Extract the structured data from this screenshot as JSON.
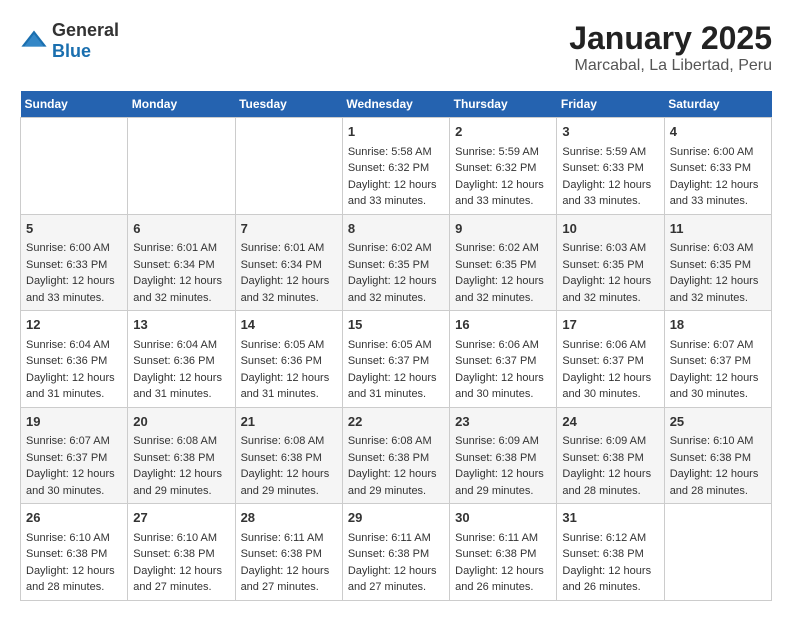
{
  "header": {
    "logo_general": "General",
    "logo_blue": "Blue",
    "month": "January 2025",
    "location": "Marcabal, La Libertad, Peru"
  },
  "days_of_week": [
    "Sunday",
    "Monday",
    "Tuesday",
    "Wednesday",
    "Thursday",
    "Friday",
    "Saturday"
  ],
  "weeks": [
    [
      {
        "day": "",
        "sunrise": "",
        "sunset": "",
        "daylight": ""
      },
      {
        "day": "",
        "sunrise": "",
        "sunset": "",
        "daylight": ""
      },
      {
        "day": "",
        "sunrise": "",
        "sunset": "",
        "daylight": ""
      },
      {
        "day": "1",
        "sunrise": "Sunrise: 5:58 AM",
        "sunset": "Sunset: 6:32 PM",
        "daylight": "Daylight: 12 hours and 33 minutes."
      },
      {
        "day": "2",
        "sunrise": "Sunrise: 5:59 AM",
        "sunset": "Sunset: 6:32 PM",
        "daylight": "Daylight: 12 hours and 33 minutes."
      },
      {
        "day": "3",
        "sunrise": "Sunrise: 5:59 AM",
        "sunset": "Sunset: 6:33 PM",
        "daylight": "Daylight: 12 hours and 33 minutes."
      },
      {
        "day": "4",
        "sunrise": "Sunrise: 6:00 AM",
        "sunset": "Sunset: 6:33 PM",
        "daylight": "Daylight: 12 hours and 33 minutes."
      }
    ],
    [
      {
        "day": "5",
        "sunrise": "Sunrise: 6:00 AM",
        "sunset": "Sunset: 6:33 PM",
        "daylight": "Daylight: 12 hours and 33 minutes."
      },
      {
        "day": "6",
        "sunrise": "Sunrise: 6:01 AM",
        "sunset": "Sunset: 6:34 PM",
        "daylight": "Daylight: 12 hours and 32 minutes."
      },
      {
        "day": "7",
        "sunrise": "Sunrise: 6:01 AM",
        "sunset": "Sunset: 6:34 PM",
        "daylight": "Daylight: 12 hours and 32 minutes."
      },
      {
        "day": "8",
        "sunrise": "Sunrise: 6:02 AM",
        "sunset": "Sunset: 6:35 PM",
        "daylight": "Daylight: 12 hours and 32 minutes."
      },
      {
        "day": "9",
        "sunrise": "Sunrise: 6:02 AM",
        "sunset": "Sunset: 6:35 PM",
        "daylight": "Daylight: 12 hours and 32 minutes."
      },
      {
        "day": "10",
        "sunrise": "Sunrise: 6:03 AM",
        "sunset": "Sunset: 6:35 PM",
        "daylight": "Daylight: 12 hours and 32 minutes."
      },
      {
        "day": "11",
        "sunrise": "Sunrise: 6:03 AM",
        "sunset": "Sunset: 6:35 PM",
        "daylight": "Daylight: 12 hours and 32 minutes."
      }
    ],
    [
      {
        "day": "12",
        "sunrise": "Sunrise: 6:04 AM",
        "sunset": "Sunset: 6:36 PM",
        "daylight": "Daylight: 12 hours and 31 minutes."
      },
      {
        "day": "13",
        "sunrise": "Sunrise: 6:04 AM",
        "sunset": "Sunset: 6:36 PM",
        "daylight": "Daylight: 12 hours and 31 minutes."
      },
      {
        "day": "14",
        "sunrise": "Sunrise: 6:05 AM",
        "sunset": "Sunset: 6:36 PM",
        "daylight": "Daylight: 12 hours and 31 minutes."
      },
      {
        "day": "15",
        "sunrise": "Sunrise: 6:05 AM",
        "sunset": "Sunset: 6:37 PM",
        "daylight": "Daylight: 12 hours and 31 minutes."
      },
      {
        "day": "16",
        "sunrise": "Sunrise: 6:06 AM",
        "sunset": "Sunset: 6:37 PM",
        "daylight": "Daylight: 12 hours and 30 minutes."
      },
      {
        "day": "17",
        "sunrise": "Sunrise: 6:06 AM",
        "sunset": "Sunset: 6:37 PM",
        "daylight": "Daylight: 12 hours and 30 minutes."
      },
      {
        "day": "18",
        "sunrise": "Sunrise: 6:07 AM",
        "sunset": "Sunset: 6:37 PM",
        "daylight": "Daylight: 12 hours and 30 minutes."
      }
    ],
    [
      {
        "day": "19",
        "sunrise": "Sunrise: 6:07 AM",
        "sunset": "Sunset: 6:37 PM",
        "daylight": "Daylight: 12 hours and 30 minutes."
      },
      {
        "day": "20",
        "sunrise": "Sunrise: 6:08 AM",
        "sunset": "Sunset: 6:38 PM",
        "daylight": "Daylight: 12 hours and 29 minutes."
      },
      {
        "day": "21",
        "sunrise": "Sunrise: 6:08 AM",
        "sunset": "Sunset: 6:38 PM",
        "daylight": "Daylight: 12 hours and 29 minutes."
      },
      {
        "day": "22",
        "sunrise": "Sunrise: 6:08 AM",
        "sunset": "Sunset: 6:38 PM",
        "daylight": "Daylight: 12 hours and 29 minutes."
      },
      {
        "day": "23",
        "sunrise": "Sunrise: 6:09 AM",
        "sunset": "Sunset: 6:38 PM",
        "daylight": "Daylight: 12 hours and 29 minutes."
      },
      {
        "day": "24",
        "sunrise": "Sunrise: 6:09 AM",
        "sunset": "Sunset: 6:38 PM",
        "daylight": "Daylight: 12 hours and 28 minutes."
      },
      {
        "day": "25",
        "sunrise": "Sunrise: 6:10 AM",
        "sunset": "Sunset: 6:38 PM",
        "daylight": "Daylight: 12 hours and 28 minutes."
      }
    ],
    [
      {
        "day": "26",
        "sunrise": "Sunrise: 6:10 AM",
        "sunset": "Sunset: 6:38 PM",
        "daylight": "Daylight: 12 hours and 28 minutes."
      },
      {
        "day": "27",
        "sunrise": "Sunrise: 6:10 AM",
        "sunset": "Sunset: 6:38 PM",
        "daylight": "Daylight: 12 hours and 27 minutes."
      },
      {
        "day": "28",
        "sunrise": "Sunrise: 6:11 AM",
        "sunset": "Sunset: 6:38 PM",
        "daylight": "Daylight: 12 hours and 27 minutes."
      },
      {
        "day": "29",
        "sunrise": "Sunrise: 6:11 AM",
        "sunset": "Sunset: 6:38 PM",
        "daylight": "Daylight: 12 hours and 27 minutes."
      },
      {
        "day": "30",
        "sunrise": "Sunrise: 6:11 AM",
        "sunset": "Sunset: 6:38 PM",
        "daylight": "Daylight: 12 hours and 26 minutes."
      },
      {
        "day": "31",
        "sunrise": "Sunrise: 6:12 AM",
        "sunset": "Sunset: 6:38 PM",
        "daylight": "Daylight: 12 hours and 26 minutes."
      },
      {
        "day": "",
        "sunrise": "",
        "sunset": "",
        "daylight": ""
      }
    ]
  ]
}
